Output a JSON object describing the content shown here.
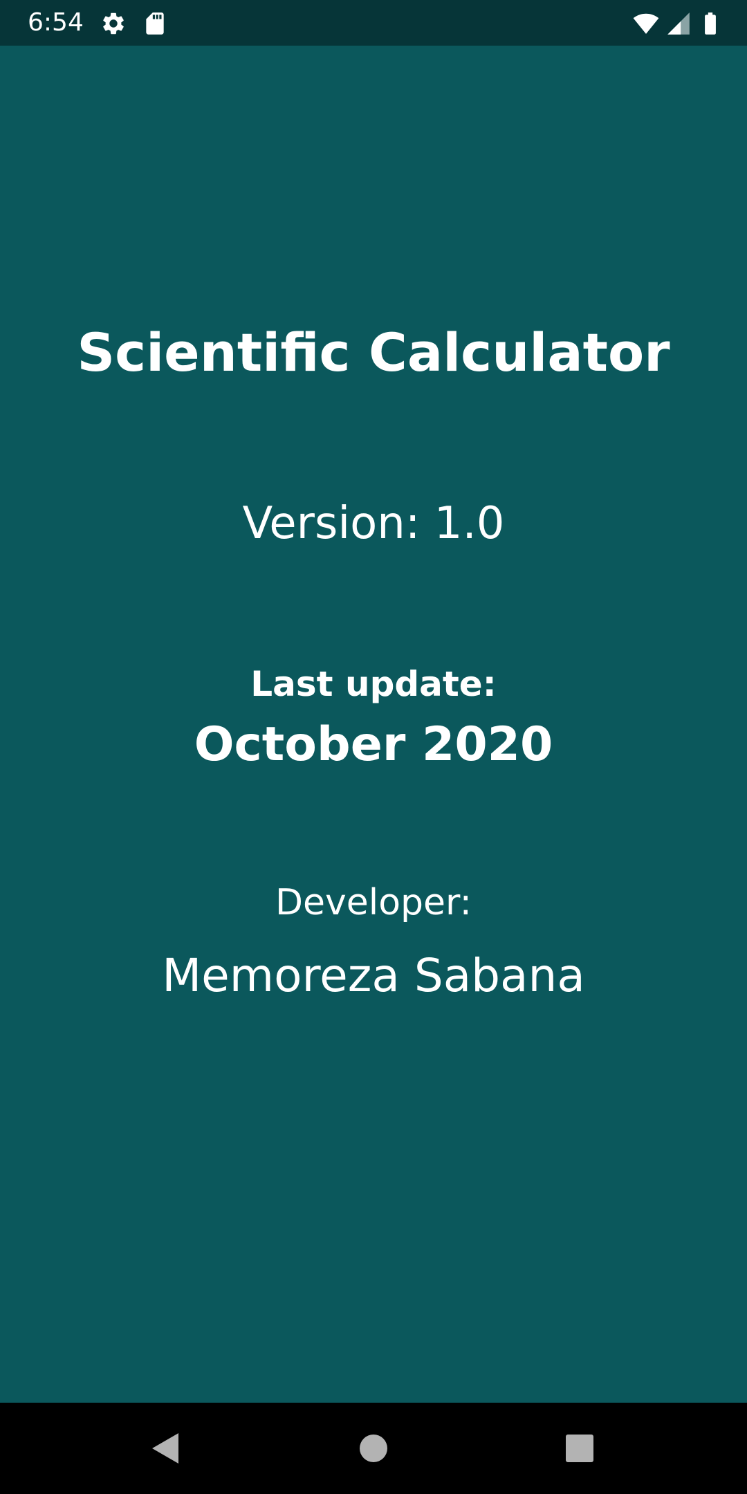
{
  "status_bar": {
    "time": "6:54",
    "icons": [
      "gear-icon",
      "sd-card-icon",
      "wifi-icon",
      "signal-icon",
      "battery-icon"
    ]
  },
  "about": {
    "title": "Scientific Calculator",
    "version": "Version: 1.0",
    "last_update_label": "Last update:",
    "last_update_value": "October 2020",
    "developer_label": "Developer:",
    "developer_name": "Memoreza Sabana"
  },
  "nav_bar": {
    "buttons": [
      "back-icon",
      "home-icon",
      "recents-icon"
    ]
  },
  "colors": {
    "background": "#0b585c",
    "status_bar": "#063538",
    "nav_bar": "#000000",
    "text": "#ffffff"
  }
}
